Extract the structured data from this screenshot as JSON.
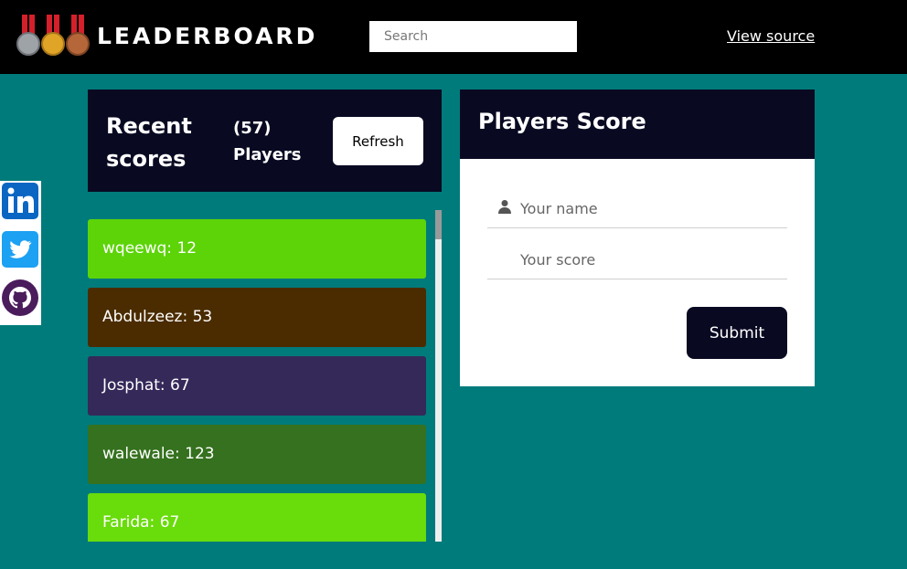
{
  "header": {
    "brand": "LEADERBOARD",
    "search_placeholder": "Search",
    "view_source": "View source",
    "logo_icon": "medals-icon"
  },
  "social": [
    {
      "name": "linkedin-icon",
      "color": "#0a66c2"
    },
    {
      "name": "twitter-icon",
      "color": "#1da1f2"
    },
    {
      "name": "github-icon",
      "color": "#4a1c5c"
    }
  ],
  "recent": {
    "title": "Recent scores",
    "count_line1": "(57)",
    "count_line2": "Players",
    "refresh_label": "Refresh"
  },
  "scores": [
    {
      "text": "wqeewq: 12",
      "color": "#5cd408"
    },
    {
      "text": "Abdulzeez: 53",
      "color": "#4b2c00"
    },
    {
      "text": "Josphat: 67",
      "color": "#35295a"
    },
    {
      "text": "walewale: 123",
      "color": "#35711e"
    },
    {
      "text": "Farida: 67",
      "color": "#69dc0b"
    }
  ],
  "form": {
    "title": "Players Score",
    "name_placeholder": "Your name",
    "score_placeholder": "Your score",
    "submit_label": "Submit"
  },
  "colors": {
    "background": "#007b7b",
    "header": "#000000",
    "panel_dark": "#090a22"
  }
}
